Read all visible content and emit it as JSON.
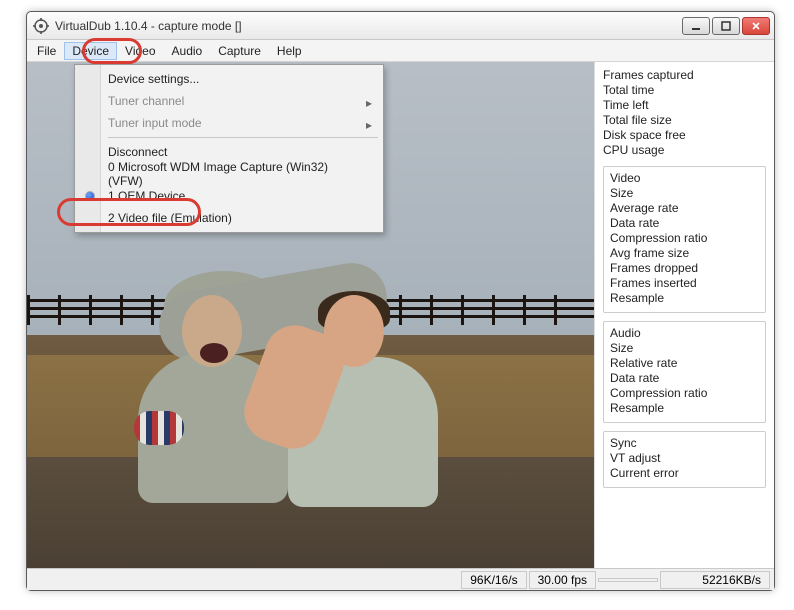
{
  "window": {
    "title": "VirtualDub 1.10.4 - capture mode []"
  },
  "menubar": {
    "items": [
      "File",
      "Device",
      "Video",
      "Audio",
      "Capture",
      "Help"
    ],
    "open_index": 1
  },
  "dropdown": {
    "settings": "Device settings...",
    "tuner_channel": "Tuner channel",
    "tuner_input": "Tuner input mode",
    "disconnect": "Disconnect",
    "dev0": "0 Microsoft WDM Image Capture (Win32) (VFW)",
    "dev1": "1 OEM Device",
    "dev2": "2 Video file (Emulation)"
  },
  "stats_top": {
    "frames_captured": "Frames captured",
    "total_time": "Total time",
    "time_left": "Time left",
    "total_file_size": "Total file size",
    "disk_free": "Disk space free",
    "cpu_usage": "CPU usage"
  },
  "stats_video": {
    "heading": "Video",
    "size": "Size",
    "avg_rate": "Average rate",
    "data_rate": "Data rate",
    "compression": "Compression ratio",
    "avg_frame_size": "Avg frame size",
    "frames_dropped": "Frames dropped",
    "frames_inserted": "Frames inserted",
    "resample": "Resample"
  },
  "stats_audio": {
    "heading": "Audio",
    "size": "Size",
    "rel_rate": "Relative rate",
    "data_rate": "Data rate",
    "compression": "Compression ratio",
    "resample": "Resample"
  },
  "stats_sync": {
    "heading": "Sync",
    "vt_adjust": "VT adjust",
    "current_error": "Current error"
  },
  "status": {
    "rate": "96K/16/s",
    "fps": "30.00 fps",
    "throughput": "52216KB/s"
  }
}
